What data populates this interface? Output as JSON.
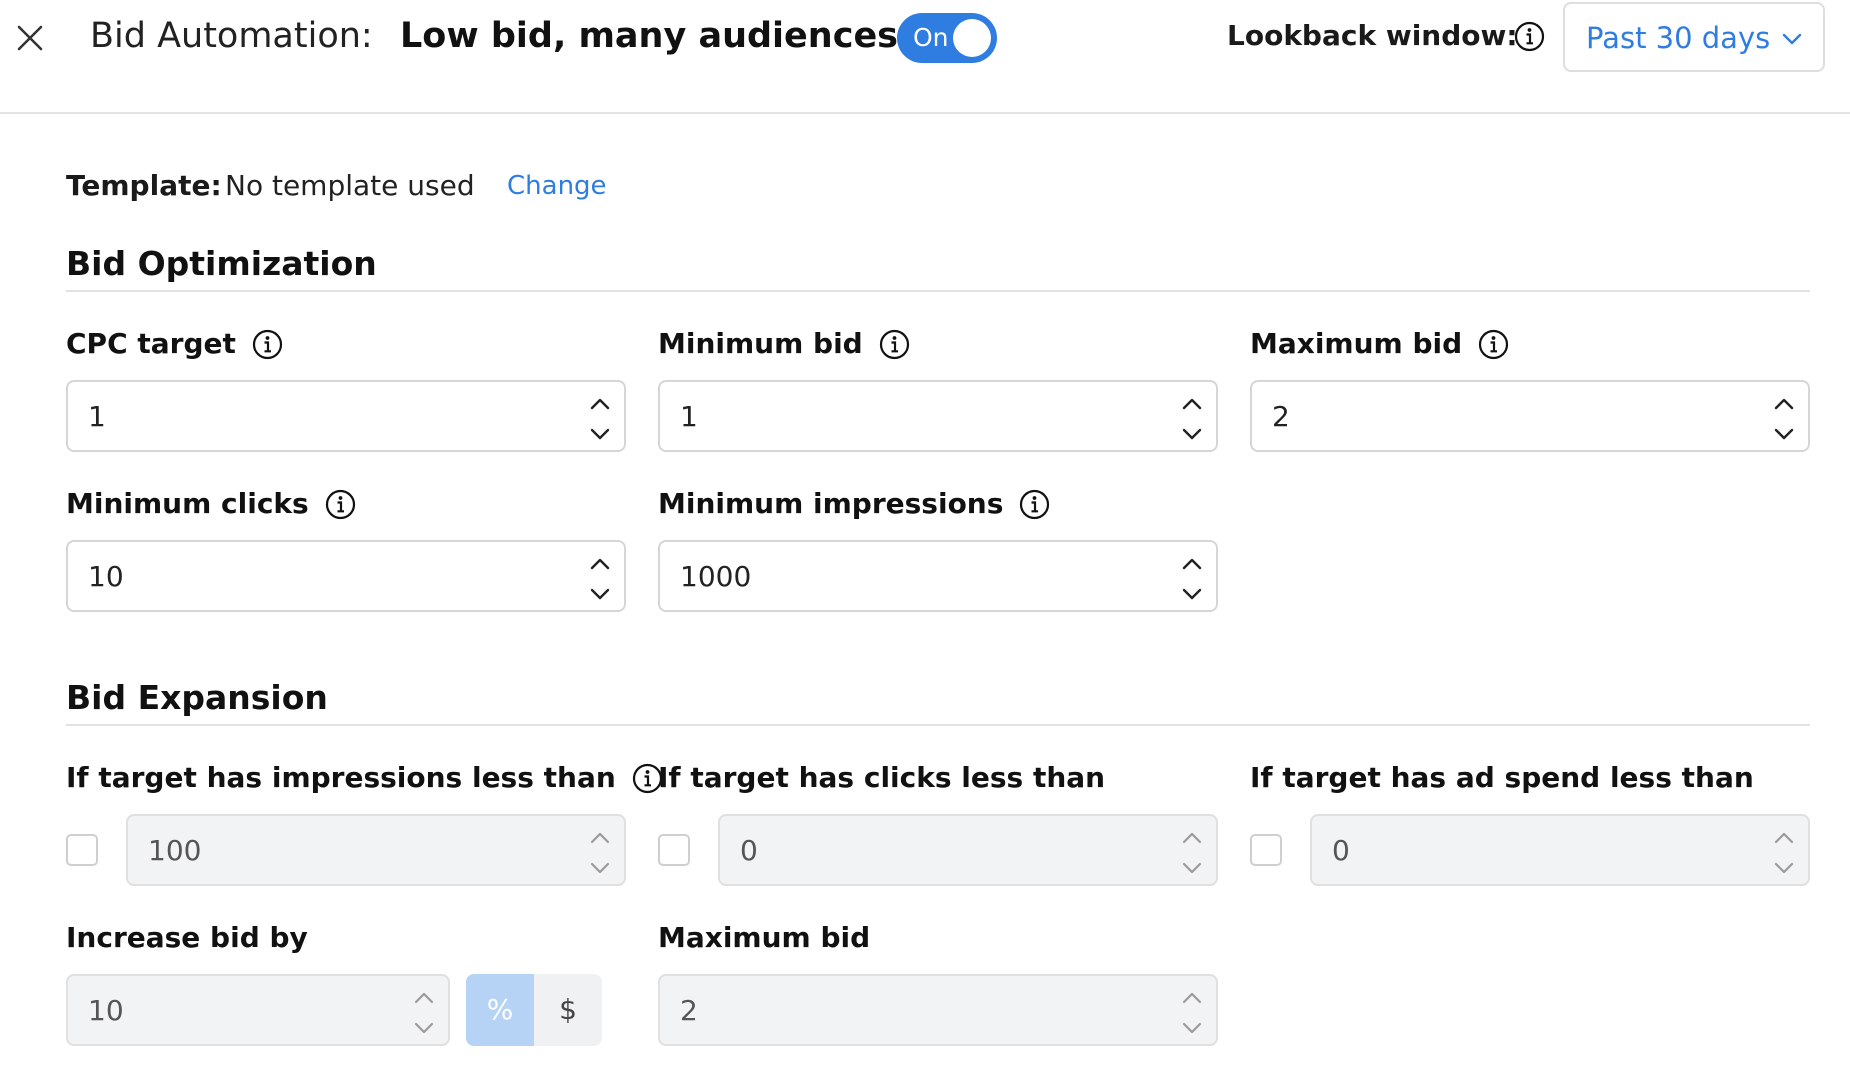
{
  "header": {
    "title_prefix": "Bid Automation:",
    "title_name": "Low bid, many audiences.",
    "toggle_label": "On",
    "lookback_label": "Lookback window:",
    "lookback_value": "Past 30 days"
  },
  "template": {
    "label": "Template:",
    "value": "No template used",
    "change_label": "Change"
  },
  "bid_optimization": {
    "title": "Bid Optimization",
    "cpc_target": {
      "label": "CPC target",
      "value": "1"
    },
    "minimum_bid": {
      "label": "Minimum bid",
      "value": "1"
    },
    "maximum_bid": {
      "label": "Maximum bid",
      "value": "2"
    },
    "minimum_clicks": {
      "label": "Minimum clicks",
      "value": "10"
    },
    "minimum_impressions": {
      "label": "Minimum impressions",
      "value": "1000"
    }
  },
  "bid_expansion": {
    "title": "Bid Expansion",
    "impressions_less_than": {
      "label": "If target has impressions less than",
      "value": "100"
    },
    "clicks_less_than": {
      "label": "If target has clicks less than",
      "value": "0"
    },
    "ad_spend_less_than": {
      "label": "If target has ad spend less than",
      "value": "0"
    },
    "increase_bid_by": {
      "label": "Increase bid by",
      "value": "10",
      "unit_percent": "%",
      "unit_dollar": "$"
    },
    "maximum_bid": {
      "label": "Maximum bid",
      "value": "2"
    }
  },
  "colors": {
    "accent": "#2f7de1",
    "unit_selected": "#b6d3f6",
    "disabled_input": "#f2f3f5"
  },
  "icons": [
    "close-icon",
    "info-icon",
    "chevron-down-icon",
    "chevron-up-icon"
  ]
}
